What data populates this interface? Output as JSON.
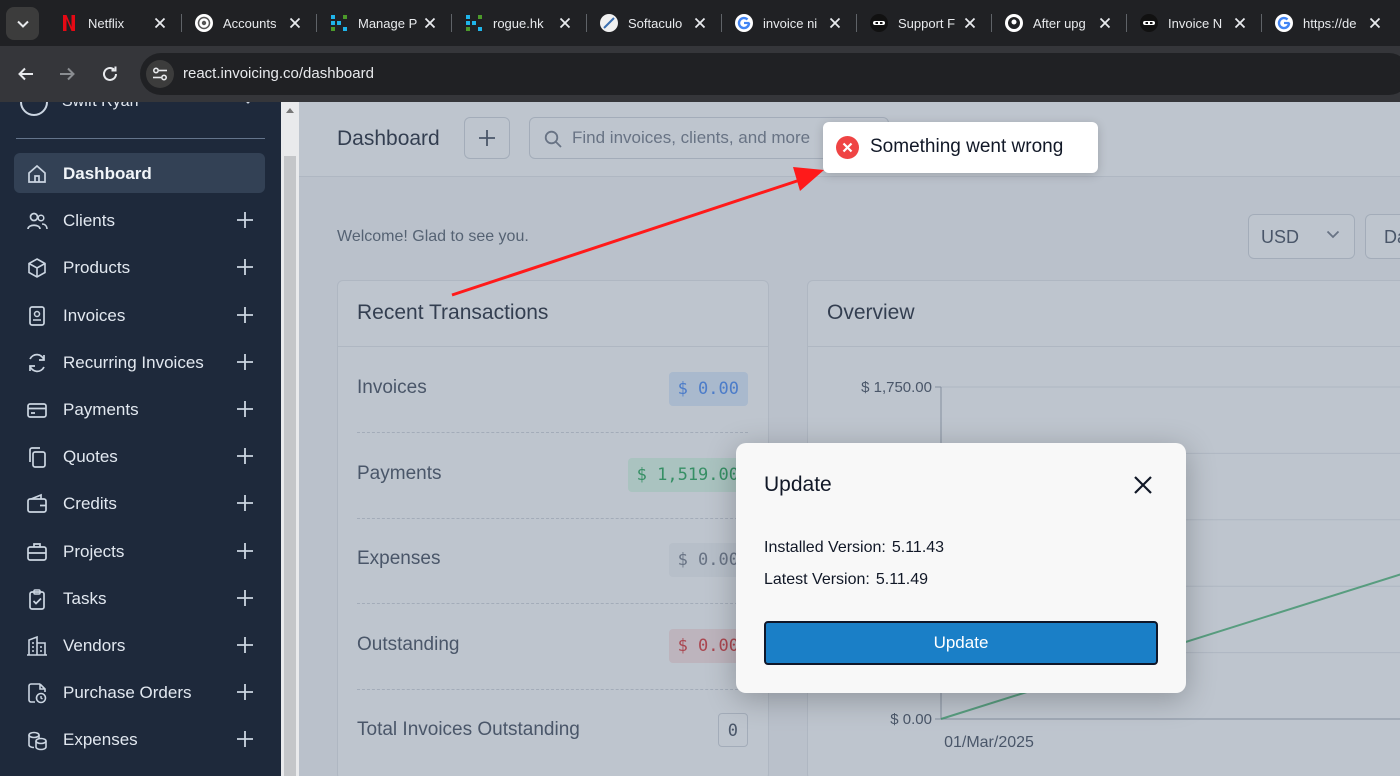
{
  "browser": {
    "tabs": [
      {
        "label": "Netflix",
        "icon": "netflix-icon"
      },
      {
        "label": "Accounts",
        "icon": "accounts-icon"
      },
      {
        "label": "Manage P",
        "icon": "grid-icon"
      },
      {
        "label": "rogue.hk",
        "icon": "grid-icon"
      },
      {
        "label": "Softaculo",
        "icon": "softaculous-icon"
      },
      {
        "label": "invoice ni",
        "icon": "google-icon"
      },
      {
        "label": "Support F",
        "icon": "ninja-icon"
      },
      {
        "label": "After upg",
        "icon": "github-icon"
      },
      {
        "label": "Invoice N",
        "icon": "ninja-icon"
      },
      {
        "label": "https://de",
        "icon": "google-icon"
      }
    ],
    "url": "react.invoicing.co/dashboard"
  },
  "sidebar": {
    "user": "Swift Ryan",
    "items": [
      {
        "label": "Dashboard",
        "icon": "home-icon",
        "active": true
      },
      {
        "label": "Clients",
        "icon": "users-icon"
      },
      {
        "label": "Products",
        "icon": "box-icon"
      },
      {
        "label": "Invoices",
        "icon": "file-icon"
      },
      {
        "label": "Recurring Invoices",
        "icon": "refresh-icon"
      },
      {
        "label": "Payments",
        "icon": "credit-card-icon"
      },
      {
        "label": "Quotes",
        "icon": "copy-icon"
      },
      {
        "label": "Credits",
        "icon": "wallet-icon"
      },
      {
        "label": "Projects",
        "icon": "briefcase-icon"
      },
      {
        "label": "Tasks",
        "icon": "clipboard-icon"
      },
      {
        "label": "Vendors",
        "icon": "building-icon"
      },
      {
        "label": "Purchase Orders",
        "icon": "file-clock-icon"
      },
      {
        "label": "Expenses",
        "icon": "coins-icon"
      }
    ]
  },
  "header": {
    "title": "Dashboard",
    "search_placeholder": "Find invoices, clients, and more"
  },
  "main": {
    "welcome": "Welcome! Glad to see you.",
    "currency": "USD",
    "date_range": "Da",
    "recent_transactions": {
      "title": "Recent Transactions",
      "rows": [
        {
          "label": "Invoices",
          "value": "$ 0.00",
          "color": "#3b82f6",
          "bg": "#dbeafe"
        },
        {
          "label": "Payments",
          "value": "$ 1,519.00",
          "color": "#16a34a",
          "bg": "#dcfce7"
        },
        {
          "label": "Expenses",
          "value": "$ 0.00",
          "color": "#6b7280",
          "bg": "#f3f4f6"
        },
        {
          "label": "Outstanding",
          "value": "$ 0.00",
          "color": "#dc2626",
          "bg": "#fee2e2"
        },
        {
          "label": "Total Invoices Outstanding",
          "value": "0",
          "color": "#374151",
          "bg": "#ffffff"
        }
      ]
    },
    "overview": {
      "title": "Overview"
    }
  },
  "chart_data": {
    "type": "line",
    "x": [
      "01/Mar/2025"
    ],
    "y_tick_labels": [
      "$ 1,750.00",
      "$ 0.00"
    ],
    "ylim": [
      0,
      1750
    ],
    "series": [
      {
        "color": "#16a34a"
      }
    ],
    "grid": true
  },
  "toast": {
    "message": "Something went wrong",
    "color": "#ef4444"
  },
  "modal": {
    "title": "Update",
    "installed_label": "Installed Version:",
    "installed_value": "5.11.43",
    "latest_label": "Latest Version:",
    "latest_value": "5.11.49",
    "button_label": "Update"
  },
  "annotation": {
    "color": "#ff1a1a"
  }
}
